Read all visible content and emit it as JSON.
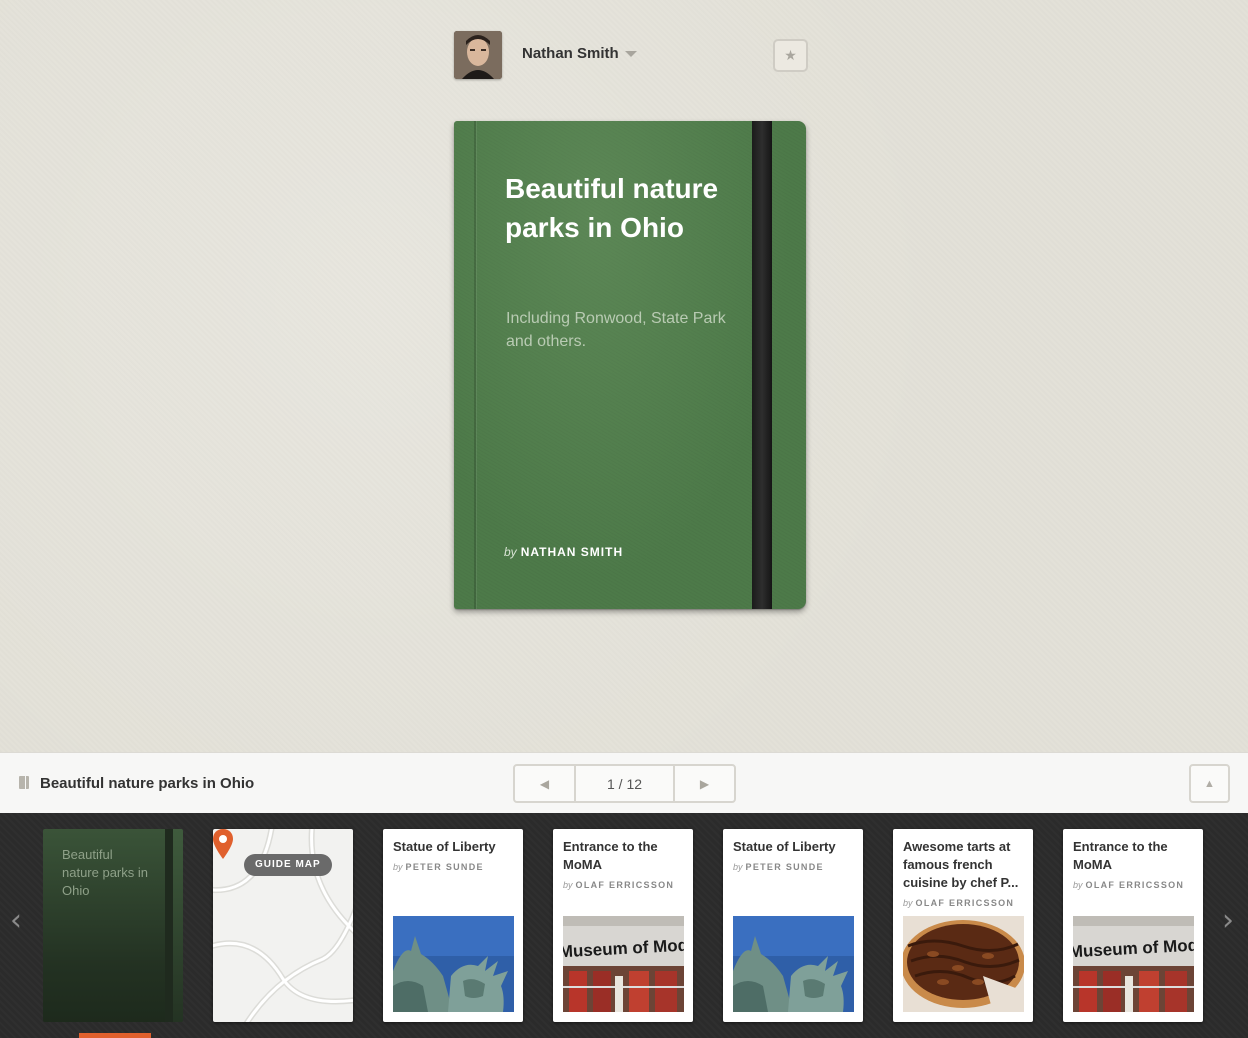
{
  "header": {
    "user_name": "Nathan Smith",
    "avatar_icon": "user-avatar",
    "star_icon": "star-icon"
  },
  "book": {
    "title": "Beautiful nature parks in Ohio",
    "subtitle": "Including Ronwood, State Park and others.",
    "by_label": "by",
    "author": "NATHAN SMITH",
    "cover_color": "#4d7a49"
  },
  "toolbar": {
    "guide_title": "Beautiful nature parks in Ohio",
    "page_count": "1 / 12",
    "prev_icon": "triangle-left-icon",
    "next_icon": "triangle-right-icon",
    "up_icon": "triangle-up-icon"
  },
  "strip": {
    "cover": {
      "title": "Beautiful nature parks in Ohio"
    },
    "map": {
      "badge": "GUIDE MAP"
    },
    "cards": [
      {
        "title": "Statue of Liberty",
        "by": "by",
        "author": "PETER SUNDE",
        "image": "statue-of-liberty"
      },
      {
        "title": "Entrance to the MoMA",
        "by": "by",
        "author": "OLAF ERRICSSON",
        "image": "moma-entrance",
        "image_text": "Museum of Modern A"
      },
      {
        "title": "Statue of Liberty",
        "by": "by",
        "author": "PETER SUNDE",
        "image": "statue-of-liberty"
      },
      {
        "title": "Awesome tarts at famous french cuisine by chef P...",
        "by": "by",
        "author": "OLAF ERRICSSON",
        "image": "pecan-tart"
      },
      {
        "title": "Entrance to the MoMA",
        "by": "by",
        "author": "OLAF ERRICSSON",
        "image": "moma-entrance",
        "image_text": "Museum of Modern A"
      }
    ],
    "accent_color": "#e0602d"
  }
}
